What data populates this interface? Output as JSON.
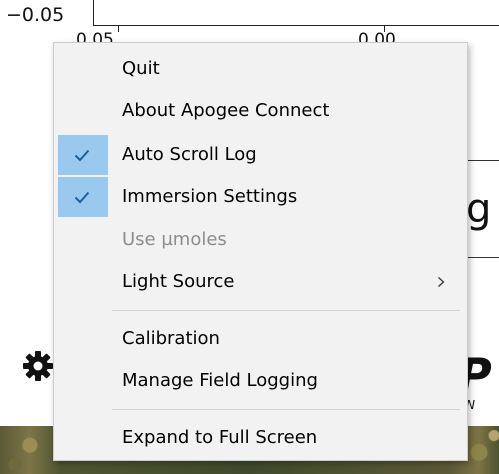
{
  "background": {
    "axis_label": "−0.05",
    "tick_labels": [
      "0.05",
      "0.00"
    ],
    "box_char": "g",
    "logo_fragment": "P",
    "logo_subtext": "N"
  },
  "menu": {
    "items": [
      {
        "label": "Quit",
        "checked": false,
        "disabled": false,
        "submenu": false
      },
      {
        "label": "About Apogee Connect",
        "checked": false,
        "disabled": false,
        "submenu": false
      },
      {
        "label": "Auto Scroll Log",
        "checked": true,
        "disabled": false,
        "submenu": false
      },
      {
        "label": "Immersion Settings",
        "checked": true,
        "disabled": false,
        "submenu": false
      },
      {
        "label": "Use µmoles",
        "checked": false,
        "disabled": true,
        "submenu": false
      },
      {
        "label": "Light Source",
        "checked": false,
        "disabled": false,
        "submenu": true
      },
      {
        "label": "Calibration",
        "checked": false,
        "disabled": false,
        "submenu": false
      },
      {
        "label": "Manage Field Logging",
        "checked": false,
        "disabled": false,
        "submenu": false
      },
      {
        "label": "Expand to Full Screen",
        "checked": false,
        "disabled": false,
        "submenu": false
      }
    ],
    "colors": {
      "background": "#f2f2f2",
      "check_highlight": "#99c9ef",
      "check_mark": "#1f5f99",
      "disabled_text": "#8d8d8d"
    },
    "icons": {
      "check": "check-icon",
      "submenu": "chevron-right-icon"
    }
  }
}
